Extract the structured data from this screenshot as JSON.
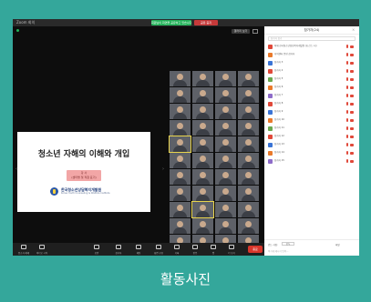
{
  "window": {
    "app_title": "Zoom 회의",
    "share_status": "회원님이 화면을 공유하고 있습니다",
    "stop_share": "공유 중지",
    "view_label": "갤러리 보기"
  },
  "slide": {
    "title": "청소년 자해의 이해와 개입",
    "badge_line1": "강 사",
    "badge_line2": "(센터명 및 직함 표기)",
    "org_name": "한국청소년상담복지개발원",
    "org_name_en": "Korea Youth Counseling & Welfare Institute"
  },
  "gallery": {
    "tiles_per_row": 4,
    "rows": 11,
    "highlight_indexes": [
      16,
      33
    ]
  },
  "toolbar": {
    "buttons": [
      "음소거 해제",
      "비디오 시작",
      "보안",
      "참가자",
      "채팅",
      "화면 공유",
      "기록",
      "반응",
      "앱",
      "더 보기"
    ],
    "end": "종료"
  },
  "participants_panel": {
    "title": "참가자(24)",
    "search_placeholder": "참가자 찾기",
    "rows": [
      {
        "name": "최재 한국청소년상담복지개발원 (호스트, 나)",
        "color": "#e0493a"
      },
      {
        "name": "지역센터 운영 참가자",
        "color": "#e97a2b"
      },
      {
        "name": "참가자 3",
        "color": "#3a74d6"
      },
      {
        "name": "참가자 4",
        "color": "#e0493a"
      },
      {
        "name": "참가자 5",
        "color": "#6aa84f"
      },
      {
        "name": "참가자 6",
        "color": "#e97a2b"
      },
      {
        "name": "참가자 7",
        "color": "#8e6cc9"
      },
      {
        "name": "참가자 8",
        "color": "#e0493a"
      },
      {
        "name": "참가자 9",
        "color": "#3a74d6"
      },
      {
        "name": "참가자 10",
        "color": "#e97a2b"
      },
      {
        "name": "참가자 11",
        "color": "#6aa84f"
      },
      {
        "name": "참가자 12",
        "color": "#e0493a"
      },
      {
        "name": "참가자 13",
        "color": "#3a74d6"
      },
      {
        "name": "참가자 14",
        "color": "#e97a2b"
      },
      {
        "name": "참가자 15",
        "color": "#8e6cc9"
      }
    ],
    "footer_to": "받는 사람:",
    "footer_select": "모두",
    "footer_file": "파일",
    "footer_input": "여기에 메시지 입력..."
  },
  "caption": "활동사진"
}
